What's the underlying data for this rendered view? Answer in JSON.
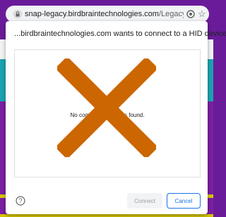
{
  "browser": {
    "url_host": "snap-legacy.birdbraintechnologies.com",
    "url_path": "/LegacySnap.ht..."
  },
  "dialog": {
    "title": "...birdbraintechnologies.com wants to connect to a HID device",
    "empty_message": "No compatible devices found.",
    "connect_label": "Connect",
    "cancel_label": "Cancel"
  },
  "colors": {
    "accent": "#1a73e8",
    "x_mark": "#cc6600",
    "page_purple": "#6a1b9a",
    "page_teal": "#1aa3b0"
  }
}
